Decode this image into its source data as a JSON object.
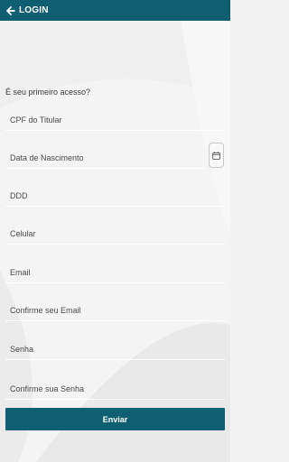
{
  "header": {
    "title": "LOGIN"
  },
  "form": {
    "subtitle": "É seu primeiro acesso?",
    "fields": [
      {
        "placeholder": "CPF do Titular"
      },
      {
        "placeholder": "Data de Nascimento"
      },
      {
        "placeholder": "DDD"
      },
      {
        "placeholder": "Celular"
      },
      {
        "placeholder": "Email"
      },
      {
        "placeholder": "Confirme seu Email"
      },
      {
        "placeholder": "Senha"
      },
      {
        "placeholder": "Confirme sua Senha"
      }
    ],
    "submit_label": "Enviar"
  },
  "icons": {
    "back": "arrow-left-icon",
    "date": "calendar-icon"
  },
  "colors": {
    "primary": "#0f5f72",
    "background": "#f2f2f2",
    "text": "#3a3a3a"
  }
}
